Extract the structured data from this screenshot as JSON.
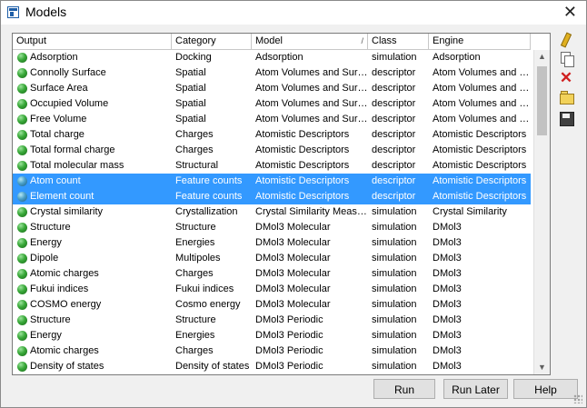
{
  "window": {
    "title": "Models"
  },
  "grid": {
    "columns": [
      "Output",
      "Category",
      "Model",
      "Class",
      "Engine"
    ],
    "rows": [
      {
        "output": "Adsorption",
        "category": "Docking",
        "model": "Adsorption",
        "class": "simulation",
        "engine": "Adsorption",
        "selected": false
      },
      {
        "output": "Connolly Surface",
        "category": "Spatial",
        "model": "Atom Volumes and Surfaces",
        "class": "descriptor",
        "engine": "Atom Volumes and Surfaces",
        "selected": false
      },
      {
        "output": "Surface Area",
        "category": "Spatial",
        "model": "Atom Volumes and Surfaces",
        "class": "descriptor",
        "engine": "Atom Volumes and Surfaces",
        "selected": false
      },
      {
        "output": "Occupied Volume",
        "category": "Spatial",
        "model": "Atom Volumes and Surfaces",
        "class": "descriptor",
        "engine": "Atom Volumes and Surfaces",
        "selected": false
      },
      {
        "output": "Free Volume",
        "category": "Spatial",
        "model": "Atom Volumes and Surfaces",
        "class": "descriptor",
        "engine": "Atom Volumes and Surfaces",
        "selected": false
      },
      {
        "output": "Total charge",
        "category": "Charges",
        "model": "Atomistic Descriptors",
        "class": "descriptor",
        "engine": "Atomistic Descriptors",
        "selected": false
      },
      {
        "output": "Total formal charge",
        "category": "Charges",
        "model": "Atomistic Descriptors",
        "class": "descriptor",
        "engine": "Atomistic Descriptors",
        "selected": false
      },
      {
        "output": "Total molecular mass",
        "category": "Structural",
        "model": "Atomistic Descriptors",
        "class": "descriptor",
        "engine": "Atomistic Descriptors",
        "selected": false
      },
      {
        "output": "Atom count",
        "category": "Feature counts",
        "model": "Atomistic Descriptors",
        "class": "descriptor",
        "engine": "Atomistic Descriptors",
        "selected": true
      },
      {
        "output": "Element count",
        "category": "Feature counts",
        "model": "Atomistic Descriptors",
        "class": "descriptor",
        "engine": "Atomistic Descriptors",
        "selected": true
      },
      {
        "output": "Crystal similarity",
        "category": "Crystallization",
        "model": "Crystal Similarity Measure",
        "class": "simulation",
        "engine": "Crystal Similarity",
        "selected": false
      },
      {
        "output": "Structure",
        "category": "Structure",
        "model": "DMol3 Molecular",
        "class": "simulation",
        "engine": "DMol3",
        "selected": false
      },
      {
        "output": "Energy",
        "category": "Energies",
        "model": "DMol3 Molecular",
        "class": "simulation",
        "engine": "DMol3",
        "selected": false
      },
      {
        "output": "Dipole",
        "category": "Multipoles",
        "model": "DMol3 Molecular",
        "class": "simulation",
        "engine": "DMol3",
        "selected": false
      },
      {
        "output": "Atomic charges",
        "category": "Charges",
        "model": "DMol3 Molecular",
        "class": "simulation",
        "engine": "DMol3",
        "selected": false
      },
      {
        "output": "Fukui indices",
        "category": "Fukui indices",
        "model": "DMol3 Molecular",
        "class": "simulation",
        "engine": "DMol3",
        "selected": false
      },
      {
        "output": "COSMO energy",
        "category": "Cosmo energy",
        "model": "DMol3 Molecular",
        "class": "simulation",
        "engine": "DMol3",
        "selected": false
      },
      {
        "output": "Structure",
        "category": "Structure",
        "model": "DMol3 Periodic",
        "class": "simulation",
        "engine": "DMol3",
        "selected": false
      },
      {
        "output": "Energy",
        "category": "Energies",
        "model": "DMol3 Periodic",
        "class": "simulation",
        "engine": "DMol3",
        "selected": false
      },
      {
        "output": "Atomic charges",
        "category": "Charges",
        "model": "DMol3 Periodic",
        "class": "simulation",
        "engine": "DMol3",
        "selected": false
      },
      {
        "output": "Density of states",
        "category": "Density of states",
        "model": "DMol3 Periodic",
        "class": "simulation",
        "engine": "DMol3",
        "selected": false
      }
    ]
  },
  "icons": {
    "title": "window-icon",
    "close": "close-icon",
    "row_marker": "green-sphere-icon",
    "tools": [
      "edit-pencil-icon",
      "copy-icon",
      "delete-icon",
      "open-folder-icon",
      "save-icon"
    ],
    "scroll_up": "chevron-up-icon",
    "scroll_down": "chevron-down-icon"
  },
  "buttons": {
    "run": "Run",
    "run_later": "Run Later",
    "help": "Help"
  },
  "colors": {
    "selection": "#3399ff",
    "marker": "#38a838",
    "delete": "#d02020"
  }
}
